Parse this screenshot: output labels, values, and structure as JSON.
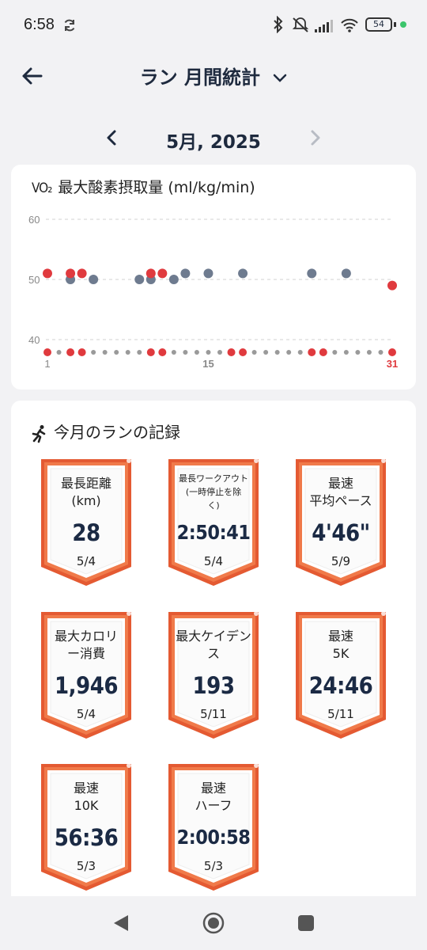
{
  "status": {
    "time": "6:58",
    "battery": "54"
  },
  "header": {
    "title": "ラン 月間統計"
  },
  "month": {
    "label": "5月, 2025"
  },
  "vo2": {
    "symbol": "VO₂",
    "title": "最大酸素摂取量 (ml/kg/min)"
  },
  "chart_data": {
    "type": "scatter",
    "title": "最大酸素摂取量 (ml/kg/min)",
    "ylim": [
      38,
      60
    ],
    "yticks": [
      "60",
      "50",
      "40"
    ],
    "xlim": [
      1,
      31
    ],
    "xticks": [
      "1",
      "15",
      "31"
    ],
    "grid": true,
    "series": [
      {
        "color": "#e03a3e",
        "points": [
          [
            1,
            51
          ],
          [
            3,
            51
          ],
          [
            4,
            51
          ],
          [
            10,
            51
          ],
          [
            11,
            51
          ],
          [
            31,
            49
          ]
        ]
      },
      {
        "color": "#6e7b8f",
        "points": [
          [
            3,
            50
          ],
          [
            5,
            50
          ],
          [
            9,
            50
          ],
          [
            10,
            50
          ],
          [
            12,
            50
          ],
          [
            13,
            51
          ],
          [
            15,
            51
          ],
          [
            18,
            51
          ],
          [
            24,
            51
          ],
          [
            27,
            51
          ]
        ]
      }
    ],
    "activity_days_red": [
      1,
      3,
      4,
      10,
      11,
      17,
      18,
      24,
      25,
      31
    ],
    "rest_color": "#9a9a9a"
  },
  "records": {
    "title": "今月のランの記録",
    "items": [
      {
        "label": "最長距離\n(km)",
        "value": "28",
        "date": "5/4"
      },
      {
        "label": "最長ワークアウト\n(一時停止を除\nく)",
        "value": "2:50:41",
        "date": "5/4"
      },
      {
        "label": "最速\n平均ペース",
        "value": "4'46\"",
        "date": "5/9"
      },
      {
        "label": "最大カロリ\nー消費",
        "value": "1,946",
        "date": "5/4"
      },
      {
        "label": "最大ケイデン\nス",
        "value": "193",
        "date": "5/11"
      },
      {
        "label": "最速\n5K",
        "value": "24:46",
        "date": "5/11"
      },
      {
        "label": "最速\n10K",
        "value": "56:36",
        "date": "5/3"
      },
      {
        "label": "最速\nハーフ",
        "value": "2:00:58",
        "date": "5/3"
      }
    ]
  }
}
